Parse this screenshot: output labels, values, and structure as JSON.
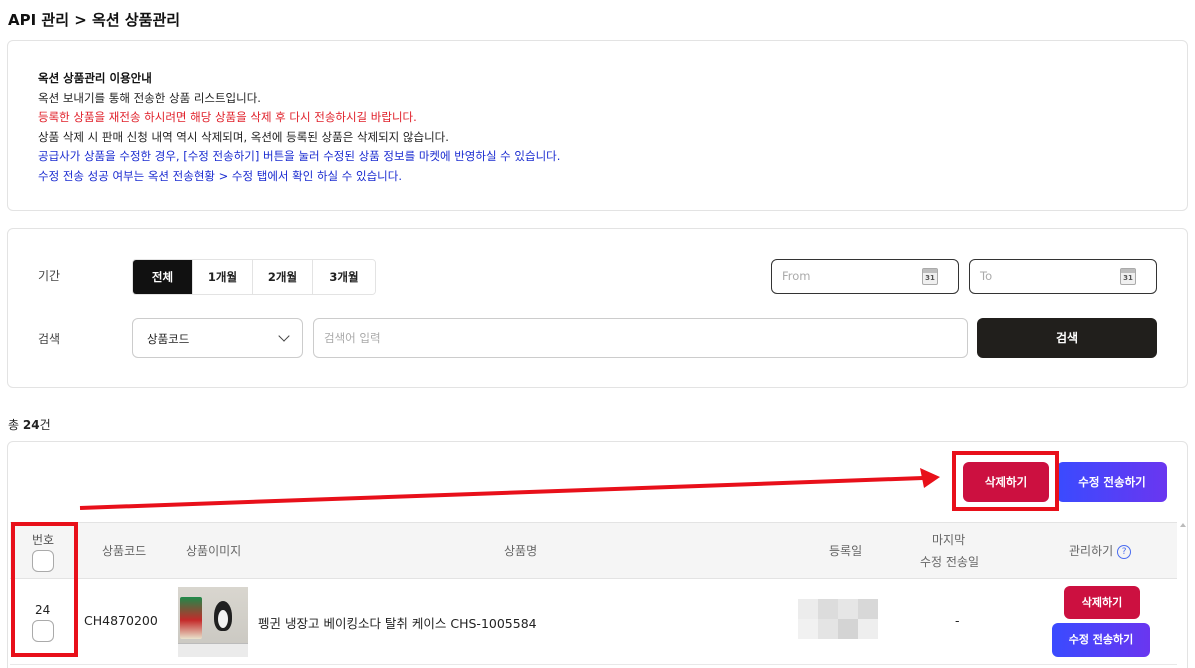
{
  "breadcrumb": "API 관리 > 옥션 상품관리",
  "notice": {
    "title": "옥션 상품관리 이용안내",
    "lines": [
      {
        "text": "옥션 보내기를 통해 전송한 상품 리스트입니다.",
        "color": "#222222"
      },
      {
        "text": "등록한 상품을 재전송 하시려면 해당 상품을 삭제 후 다시 전송하시길 바랍니다.",
        "color": "#e0202a"
      },
      {
        "text": "상품 삭제 시 판매 신청 내역 역시 삭제되며, 옥션에 등록된 상품은 삭제되지 않습니다.",
        "color": "#222222"
      },
      {
        "text": "공급사가 상품을 수정한 경우, [수정 전송하기] 버튼을 눌러 수정된 상품 정보를 마켓에 반영하실 수 있습니다.",
        "color": "#1a2bd0"
      },
      {
        "text": "수정 전송 성공 여부는 옥션 전송현황 > 수정 탭에서 확인 하실 수 있습니다.",
        "color": "#1a2bd0"
      }
    ]
  },
  "filter": {
    "period_label": "기간",
    "period_options": [
      "전체",
      "1개월",
      "2개월",
      "3개월"
    ],
    "period_selected": "전체",
    "from_placeholder": "From",
    "to_placeholder": "To",
    "calendar_day": "31",
    "search_label": "검색",
    "search_type": "상품코드",
    "search_placeholder": "검색어 입력",
    "search_button": "검색"
  },
  "total": {
    "prefix": "총 ",
    "count": "24",
    "suffix": "건"
  },
  "actions": {
    "delete": "삭제하기",
    "edit_send": "수정 전송하기"
  },
  "table": {
    "headers": {
      "number": "번호",
      "code": "상품코드",
      "image": "상품이미지",
      "name": "상품명",
      "registered": "등록일",
      "last_edit_1": "마지막",
      "last_edit_2": "수정 전송일",
      "manage": "관리하기"
    },
    "rows": [
      {
        "number": "24",
        "code": "CH4870200",
        "image": "penguin-baking-soda-product-photo",
        "name": "펭귄 냉장고 베이킹소다 탈취 케이스 CHS-1005584",
        "registered": "",
        "last_edit": "-",
        "delete": "삭제하기",
        "edit_send": "수정 전송하기"
      }
    ]
  },
  "colors": {
    "delete": "#cc1040",
    "edit_start": "#3a4bff",
    "edit_end": "#6a36f0",
    "highlight": "#e8101a",
    "search_button": "#211f1c"
  }
}
